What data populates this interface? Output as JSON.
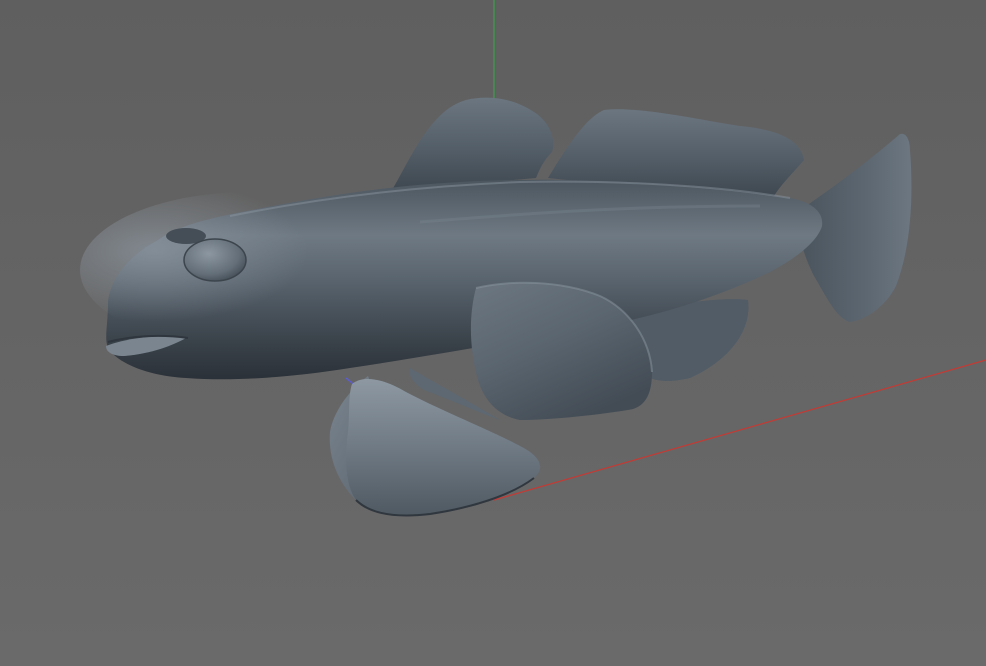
{
  "viewport": {
    "background_top": "#5e5e5e",
    "background_bottom": "#6a6a6a"
  },
  "axes": {
    "x_axis_color": "#c43a34",
    "y_axis_color": "#3aa04a",
    "z_axis_color": "#5a5ae0"
  },
  "model": {
    "object": "fish-model",
    "body_light": "#7b8690",
    "body_mid": "#55606a",
    "body_dark": "#2e353c",
    "rim_light": "#a7b1ba"
  }
}
